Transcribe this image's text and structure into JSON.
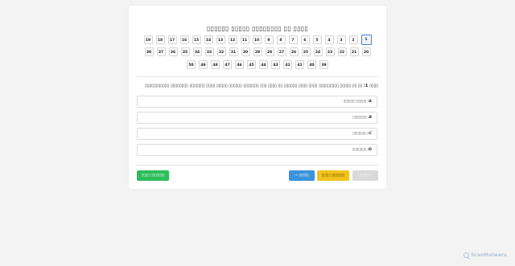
{
  "quiz": {
    "title": "▯▯▯▯ ▯▯ ▯▯▯▯▯▯▯▯ ▯▯▯▯▯ ▯▯▯▯▯▯",
    "question_numbers_rows": [
      [
        "1",
        "2",
        "3",
        "4",
        "5",
        "6",
        "7",
        "8",
        "9",
        "10",
        "11",
        "12",
        "13",
        "14",
        "15",
        "16",
        "17",
        "18",
        "19"
      ],
      [
        "20",
        "21",
        "22",
        "23",
        "24",
        "25",
        "26",
        "27",
        "28",
        "29",
        "30",
        "31",
        "32",
        "33",
        "34",
        "35",
        "36",
        "37",
        "38"
      ],
      [
        "39",
        "40",
        "41",
        "42",
        "43",
        "44",
        "45",
        "46",
        "47",
        "48",
        "49",
        "50"
      ]
    ],
    "active_question": "1",
    "question_label": "▯▯▯▯",
    "question_number": "1:",
    "question_text": "▯▯ ▯▯ ▯▯▯▯▯ ▯▯▯▯▯▯▯▯▯ ▯▯▯▯ ▯▯▯▯ ▯▯▯▯▯▯ ▯▯ ▯▯▯▯ ▯▯▯ ▯▯▯▯▯▯▯ ▯▯▯▯▯▯ ▯▯▯▯▯ ▯▯▯▯ ▯▯▯▯▯▯▯ ▯▯▯▯▯▯▯▯ ▯▯▯▯▯▯▯▯▯▯▯",
    "options": [
      {
        "letter": "A:",
        "text": "▯▯▯▯▯ ▯▯▯▯▯▯"
      },
      {
        "letter": "B:",
        "text": "▯▯▯▯▯▯▯"
      },
      {
        "letter": "C:",
        "text": "▯▯▯▯▯▯▯"
      },
      {
        "letter": "D:",
        "text": "▯▯▯▯▯▯▯"
      }
    ],
    "buttons": {
      "finish": "▯▯▯▯▯▯▯ ▯▯▯▯",
      "prev": "▯▯▯▯▯ →",
      "mark": "▯▯▯▯▯▯▯ ▯▯▯▯",
      "next": "← ▯▯▯▯▯"
    }
  },
  "watermark": "ScanMalware",
  "colors": {
    "finish": "#2dbd5a",
    "prev": "#3a93dc",
    "mark": "#f2c21d",
    "next_disabled": "#d9d9d9",
    "active_outline": "#3f7fd6"
  }
}
